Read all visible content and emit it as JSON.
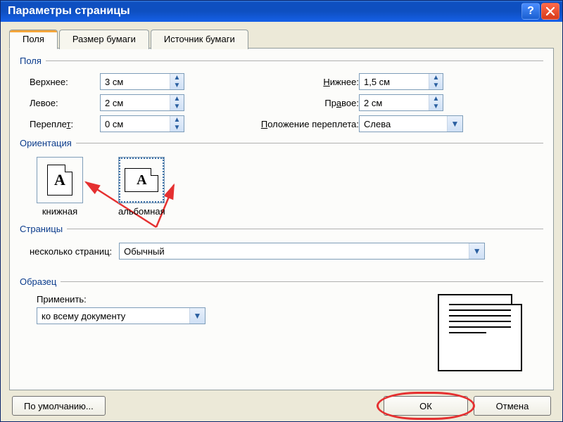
{
  "title": "Параметры страницы",
  "tabs": {
    "margins": "Поля",
    "paper": "Размер бумаги",
    "source": "Источник бумаги"
  },
  "groups": {
    "margins": "Поля",
    "orientation": "Ориентация",
    "pages": "Страницы",
    "sample": "Образец"
  },
  "margins": {
    "top_label": "Верхнее:",
    "top_value": "3 см",
    "bottom_label_pre": "Н",
    "bottom_label_post": "ижнее:",
    "bottom_value": "1,5 см",
    "left_label": "Левое:",
    "left_value": "2 см",
    "right_label_pre": "Пр",
    "right_label_post": "авое:",
    "right_value": "2 см",
    "gutter_label_pre": "Перепле",
    "gutter_label_post": "т:",
    "gutter_value": "0 см",
    "gutter_pos_label_pre": "П",
    "gutter_pos_label_post": "оложение переплета:",
    "gutter_pos_value": "Слева"
  },
  "orientation": {
    "portrait_pre": "к",
    "portrait_post": "нижная",
    "landscape_pre": "а",
    "landscape_post": "льбомная"
  },
  "pages": {
    "multi_label": "несколько страниц:",
    "multi_value": "Обычный"
  },
  "sample": {
    "apply_label": "Применить:",
    "apply_value": "ко всему документу"
  },
  "buttons": {
    "default": "По умолчанию...",
    "ok": "ОК",
    "cancel": "Отмена"
  }
}
